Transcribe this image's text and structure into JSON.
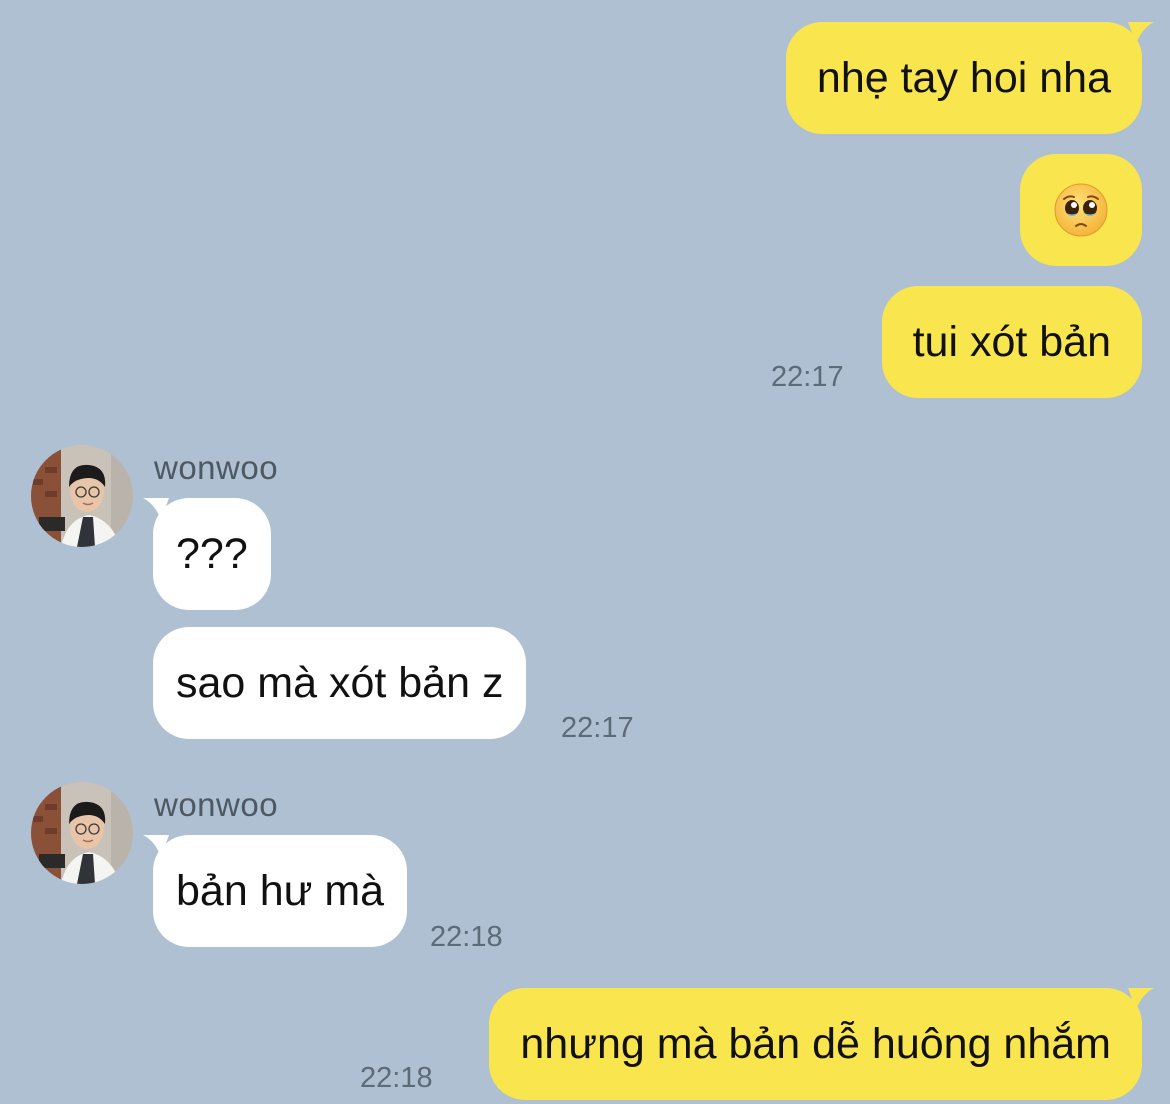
{
  "colors": {
    "background": "#aec0d1",
    "outgoing_bubble": "#f9e54e",
    "incoming_bubble": "#ffffff",
    "timestamp_text": "#5d6a78"
  },
  "messages": {
    "m1": {
      "text": "nhẹ tay hoi nha"
    },
    "m2": {
      "emoji": "pleading-face-icon"
    },
    "m3": {
      "text": "tui xót bản",
      "time": "22:17"
    },
    "g1": {
      "sender": "wonwoo",
      "avatar": "avatar-photo",
      "m4": {
        "text": "???"
      },
      "m5": {
        "text": "sao mà xót bản z",
        "time": "22:17"
      }
    },
    "g2": {
      "sender": "wonwoo",
      "avatar": "avatar-photo",
      "m6": {
        "text": "bản hư mà",
        "time": "22:18"
      }
    },
    "m7": {
      "text": "nhưng mà bản dễ huông nhắm",
      "time": "22:18"
    }
  }
}
